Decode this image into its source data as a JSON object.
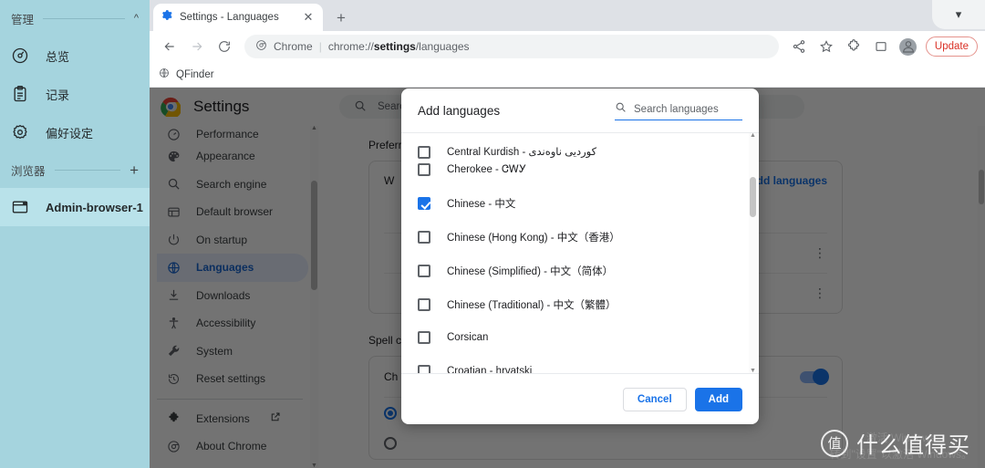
{
  "app_sidebar": {
    "groups": [
      {
        "label": "管理",
        "collapse_icon": "chevron-up-icon"
      },
      {
        "label": "浏览器",
        "add_icon": "plus-icon"
      }
    ],
    "manage_items": [
      {
        "label": "总览",
        "icon": "overview-icon"
      },
      {
        "label": "记录",
        "icon": "clipboard-icon"
      },
      {
        "label": "偏好设定",
        "icon": "gear-icon"
      }
    ],
    "browser_items": [
      {
        "label": "Admin-browser-1",
        "icon": "window-icon",
        "active": true
      }
    ]
  },
  "browser": {
    "tab": {
      "title": "Settings - Languages",
      "favicon": "settings-gear-icon",
      "close_icon": "close-icon"
    },
    "new_tab_label": "+",
    "tabstrip_chevron": "chevron-down-icon",
    "nav": {
      "back": "back-arrow-icon",
      "forward": "forward-arrow-icon",
      "reload": "reload-icon"
    },
    "omnibox": {
      "chip_icon": "chrome-icon",
      "chip_label": "Chrome",
      "url_prefix": "chrome://",
      "url_bold": "settings",
      "url_suffix": "/languages"
    },
    "actions": [
      {
        "name": "share-icon"
      },
      {
        "name": "bookmark-star-icon"
      },
      {
        "name": "extensions-puzzle-icon"
      },
      {
        "name": "side-panel-icon"
      },
      {
        "name": "profile-avatar-icon"
      }
    ],
    "update_label": "Update",
    "bookmarks": [
      {
        "label": "QFinder",
        "icon": "globe-icon"
      }
    ]
  },
  "settings": {
    "title": "Settings",
    "search_placeholder": "Search settings",
    "search_icon": "search-icon",
    "logo_icon": "chrome-logo-icon",
    "nav_items": [
      {
        "label": "Performance",
        "icon": "speedometer-icon",
        "partial": true
      },
      {
        "label": "Appearance",
        "icon": "palette-icon"
      },
      {
        "label": "Search engine",
        "icon": "search-icon"
      },
      {
        "label": "Default browser",
        "icon": "browser-window-icon"
      },
      {
        "label": "On startup",
        "icon": "power-icon"
      },
      {
        "label": "Languages",
        "icon": "globe-icon",
        "selected": true
      },
      {
        "label": "Downloads",
        "icon": "download-icon"
      },
      {
        "label": "Accessibility",
        "icon": "accessibility-icon"
      },
      {
        "label": "System",
        "icon": "wrench-icon"
      },
      {
        "label": "Reset settings",
        "icon": "history-restore-icon"
      }
    ],
    "nav_items_secondary": [
      {
        "label": "Extensions",
        "icon": "puzzle-icon",
        "external_icon": "open-in-new-icon"
      },
      {
        "label": "About Chrome",
        "icon": "chrome-circle-icon"
      }
    ],
    "sections": [
      {
        "title": "Preferred languages",
        "row_label": "W",
        "action_label": "Add languages"
      },
      {
        "title": "Spell check",
        "row_label": "Ch"
      }
    ]
  },
  "dialog": {
    "title": "Add languages",
    "search_placeholder": "Search languages",
    "search_icon": "search-icon",
    "languages": [
      {
        "label": "Central Kurdish - کوردیی ناوەندی",
        "checked": false,
        "clipped": true
      },
      {
        "label": "Cherokee - ᏣᎳᎩ",
        "checked": false
      },
      {
        "label": "Chinese - 中文",
        "checked": true
      },
      {
        "label": "Chinese (Hong Kong) - 中文（香港）",
        "checked": false
      },
      {
        "label": "Chinese (Simplified) - 中文（简体）",
        "checked": false
      },
      {
        "label": "Chinese (Traditional) - 中文（繁體）",
        "checked": false
      },
      {
        "label": "Corsican",
        "checked": false
      },
      {
        "label": "Croatian - hrvatski",
        "checked": false
      }
    ],
    "cancel_label": "Cancel",
    "add_label": "Add"
  },
  "watermarks": {
    "windows_line1": "激活 Windows",
    "windows_line2": "转到\"设置\"以激活 Windows。",
    "smzdm_logo": "值",
    "smzdm_text": "什么值得买"
  },
  "colors": {
    "accent_blue": "#1a73e8",
    "sidebar_bg": "#a5d4de",
    "update_red": "#d93025"
  }
}
